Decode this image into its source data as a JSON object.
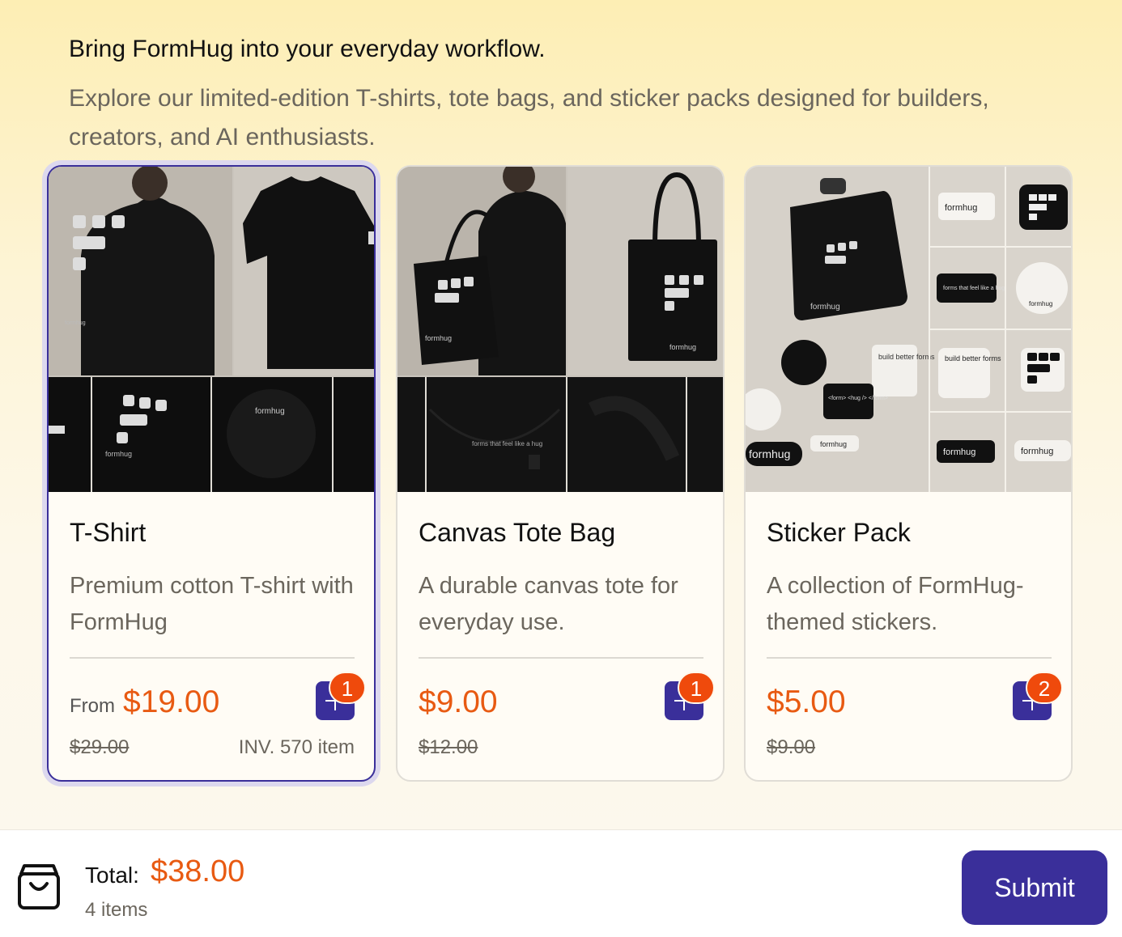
{
  "intro": {
    "headline": "Bring FormHug into your everyday workflow.",
    "subtext": "Explore our limited-edition T-shirts, tote bags, and sticker packs designed for builders, creators, and AI enthusiasts."
  },
  "products": [
    {
      "title": "T-Shirt",
      "description": "Premium cotton T-shirt with FormHug",
      "price_prefix": "From",
      "price": "$19.00",
      "original_price": "$29.00",
      "inventory": "INV. 570 item",
      "quantity": "1",
      "selected": true
    },
    {
      "title": "Canvas Tote Bag",
      "description": "A durable canvas tote for everyday use.",
      "price": "$9.00",
      "original_price": "$12.00",
      "quantity": "1"
    },
    {
      "title": "Sticker Pack",
      "description": "A collection of FormHug-themed stickers.",
      "price": "$5.00",
      "original_price": "$9.00",
      "quantity": "2"
    }
  ],
  "image_text": {
    "brand": "formhug",
    "tagline": "forms that feel like a hug",
    "sticker_build": "build better forms",
    "sticker_code": "<form> <hug /> </form>"
  },
  "footer": {
    "total_label": "Total:",
    "total_value": "$38.00",
    "items_count": "4 items",
    "submit_label": "Submit"
  },
  "colors": {
    "accent": "#3a2f9a",
    "price": "#e85a12",
    "badge": "#ef4a0c"
  },
  "icons": [
    "plus-icon",
    "shopping-bag-icon"
  ]
}
